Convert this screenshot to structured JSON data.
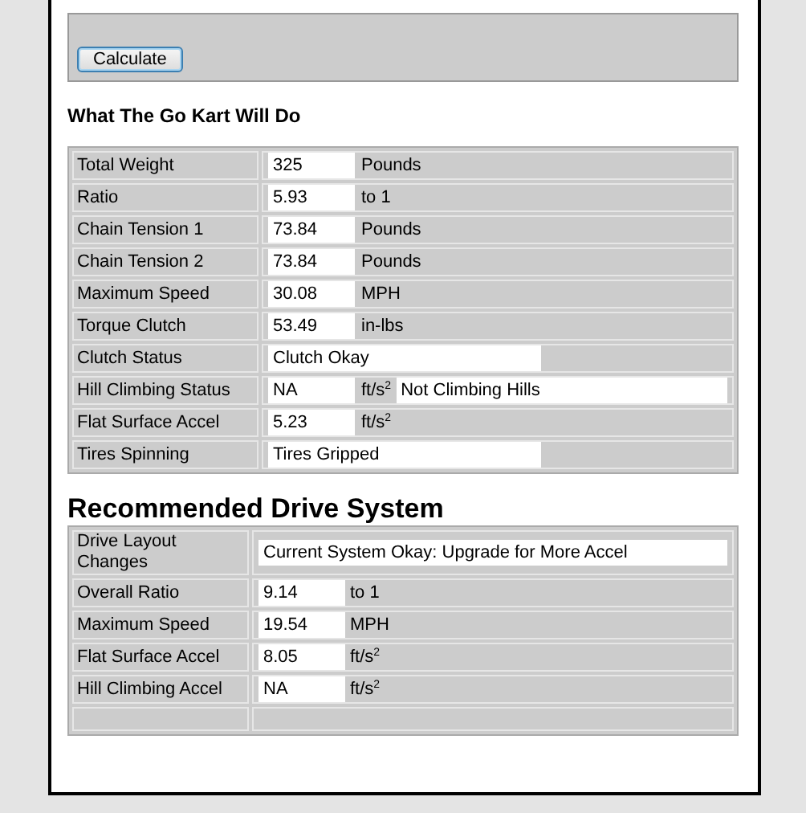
{
  "calculate_button": "Calculate",
  "results": {
    "title": "What The Go Kart Will Do",
    "rows": [
      {
        "label": "Total Weight",
        "kind": "short",
        "value": "325",
        "unit": "Pounds"
      },
      {
        "label": "Ratio",
        "kind": "short",
        "value": "5.93",
        "unit": "to 1"
      },
      {
        "label": "Chain Tension 1",
        "kind": "short",
        "value": "73.84",
        "unit": "Pounds"
      },
      {
        "label": "Chain Tension 2",
        "kind": "short",
        "value": "73.84",
        "unit": "Pounds"
      },
      {
        "label": "Maximum Speed",
        "kind": "short",
        "value": "30.08",
        "unit": "MPH"
      },
      {
        "label": "Torque Clutch",
        "kind": "short",
        "value": "53.49",
        "unit": "in-lbs"
      },
      {
        "label": "Clutch Status",
        "kind": "long",
        "value": "Clutch Okay"
      },
      {
        "label": "Hill Climbing Status",
        "kind": "short",
        "value": "NA",
        "unit": "ft/s$^{2}$",
        "note": "Not Climbing Hills"
      },
      {
        "label": "Flat Surface Accel",
        "kind": "short",
        "value": "5.23",
        "unit": "ft/s$^{2}$"
      },
      {
        "label": "Tires Spinning",
        "kind": "long",
        "value": "Tires Gripped"
      }
    ]
  },
  "recommended": {
    "title": "Recommended Drive System",
    "rows": [
      {
        "label": "Drive Layout Changes",
        "kind": "full",
        "value": "Current System Okay: Upgrade for More Accel"
      },
      {
        "label": "Overall Ratio",
        "kind": "short",
        "value": "9.14",
        "unit": "to 1"
      },
      {
        "label": "Maximum Speed",
        "kind": "short",
        "value": "19.54",
        "unit": "MPH"
      },
      {
        "label": "Flat Surface Accel",
        "kind": "short",
        "value": "8.05",
        "unit": "ft/s$^{2}$"
      },
      {
        "label": "Hill Climbing Accel",
        "kind": "short",
        "value": "NA",
        "unit": "ft/s$^{2}$"
      },
      {
        "label": "",
        "kind": "empty"
      }
    ]
  }
}
